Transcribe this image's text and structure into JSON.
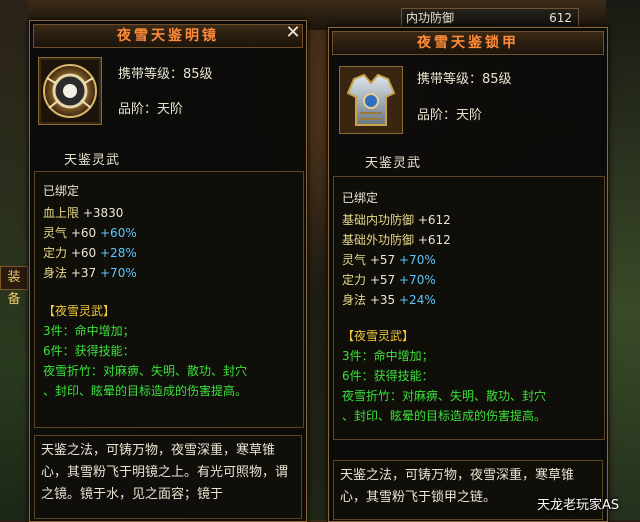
{
  "background": {
    "stat_label": "内功防御",
    "stat_value": "612",
    "equip_label": "装备"
  },
  "left_item": {
    "title": "夜雪天鉴明镜",
    "icon": "mirror-icon",
    "carry_level": "携带等级：85级",
    "grade": "品阶：天阶",
    "subtitle": "天鉴灵武",
    "bound": "已绑定",
    "stats": [
      {
        "name": "血上限",
        "value": "+3830",
        "bonus": ""
      },
      {
        "name": "灵气",
        "value": "+60",
        "bonus": "+60%"
      },
      {
        "name": "定力",
        "value": "+60",
        "bonus": "+28%"
      },
      {
        "name": "身法",
        "value": "+37",
        "bonus": "+70%"
      }
    ],
    "set_name": "【夜雪灵武】",
    "set_3": "3件：命中增加；",
    "set_6": "6件：获得技能：",
    "set_skill_1": "夜雪折竹：对麻痹、失明、散功、封穴",
    "set_skill_2": "、封印、眩晕的目标造成的伤害提高。",
    "flavor": "天鉴之法，可铸万物，夜雪深重，寒草锥心，其雪粉飞于明镜之上。有光可照物，谓之镜。镜于水，见之面容；镜于"
  },
  "right_item": {
    "title": "夜雪天鉴锁甲",
    "icon": "armor-icon",
    "carry_level": "携带等级：85级",
    "grade": "品阶：天阶",
    "subtitle": "天鉴灵武",
    "bound": "已绑定",
    "base_stats": [
      {
        "name": "基础内功防御",
        "value": "+612"
      },
      {
        "name": "基础外功防御",
        "value": "+612"
      }
    ],
    "stats": [
      {
        "name": "灵气",
        "value": "+57",
        "bonus": "+70%"
      },
      {
        "name": "定力",
        "value": "+57",
        "bonus": "+70%"
      },
      {
        "name": "身法",
        "value": "+35",
        "bonus": "+24%"
      }
    ],
    "set_name": "【夜雪灵武】",
    "set_3": "3件：命中增加；",
    "set_6": "6件：获得技能：",
    "set_skill_1": "夜雪折竹：对麻痹、失明、散功、封穴",
    "set_skill_2": "、封印、眩晕的目标造成的伤害提高。",
    "flavor": "天鉴之法，可铸万物，夜雪深重，寒草锥心，其雪粉飞于锁甲之链。"
  },
  "watermark": "天龙老玩家AS"
}
